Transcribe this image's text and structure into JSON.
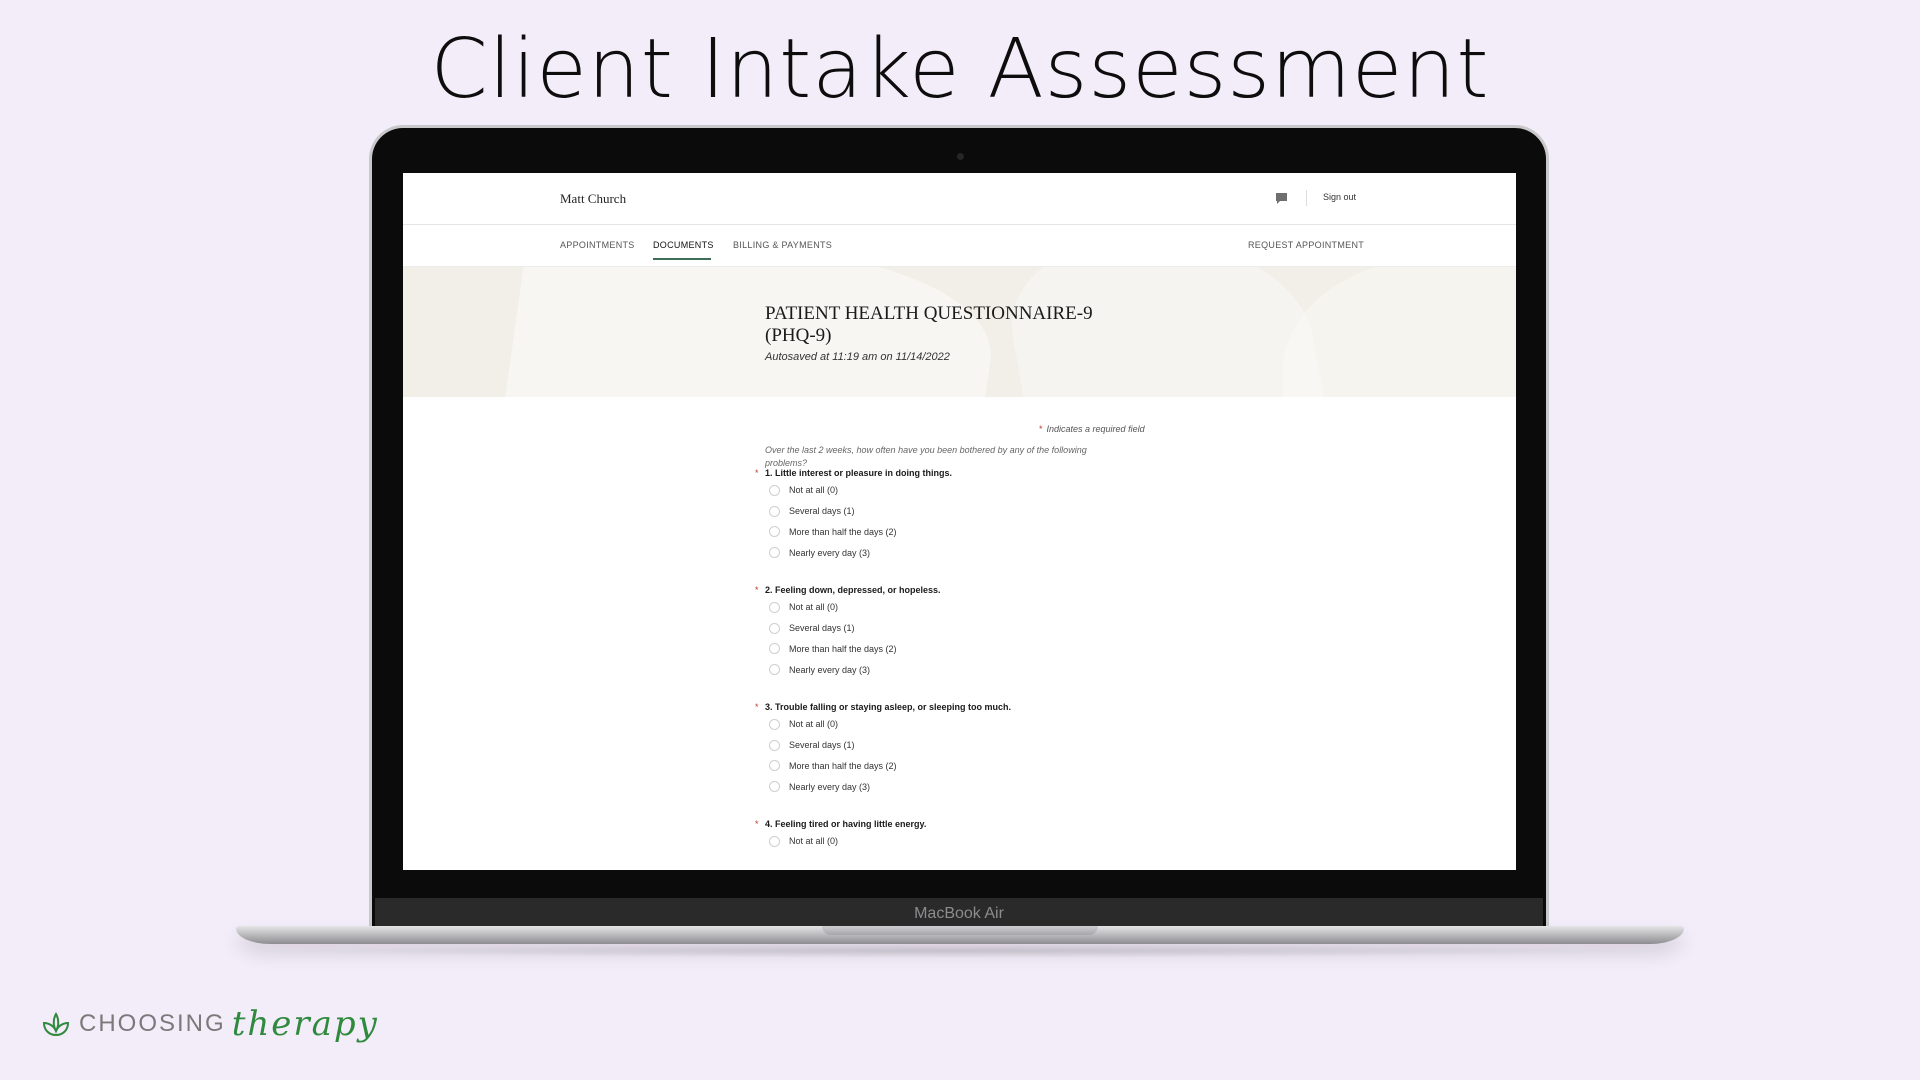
{
  "headline": "Client Intake Assessment",
  "laptop_label": "MacBook Air",
  "app": {
    "user_name": "Matt Church",
    "sign_out": "Sign out",
    "nav": {
      "appointments": "APPOINTMENTS",
      "documents": "DOCUMENTS",
      "billing": "BILLING & PAYMENTS",
      "request": "REQUEST APPOINTMENT"
    },
    "active_tab": "DOCUMENTS",
    "document": {
      "title_line1": "PATIENT HEALTH QUESTIONNAIRE-9",
      "title_line2": "(PHQ-9)",
      "autosave": "Autosaved at 11:19 am on 11/14/2022"
    },
    "form": {
      "required_star": "*",
      "required_note": "Indicates a required field",
      "instructions": "Over the last 2 weeks, how often have you been bothered by any of the following problems?",
      "questions": [
        {
          "label": "1. Little interest or pleasure in doing things.",
          "options": [
            "Not at all (0)",
            "Several days (1)",
            "More than half the days (2)",
            "Nearly every day (3)"
          ]
        },
        {
          "label": "2. Feeling down, depressed, or hopeless.",
          "options": [
            "Not at all (0)",
            "Several days (1)",
            "More than half the days (2)",
            "Nearly every day (3)"
          ]
        },
        {
          "label": "3. Trouble falling or staying asleep, or sleeping too much.",
          "options": [
            "Not at all (0)",
            "Several days (1)",
            "More than half the days (2)",
            "Nearly every day (3)"
          ]
        },
        {
          "label": "4. Feeling tired or having little energy.",
          "options": [
            "Not at all (0)"
          ]
        }
      ]
    }
  },
  "brand": {
    "word1": "CHOOSING",
    "word2": "therapy",
    "green": "#2f8a3e"
  },
  "icons": {
    "chat": "chat-bubble-icon",
    "logo": "leaf-icon"
  },
  "colors": {
    "background": "#f3ecf9",
    "banner": "#f2efe8",
    "accent": "#3d6e57",
    "required": "#c0392b"
  }
}
